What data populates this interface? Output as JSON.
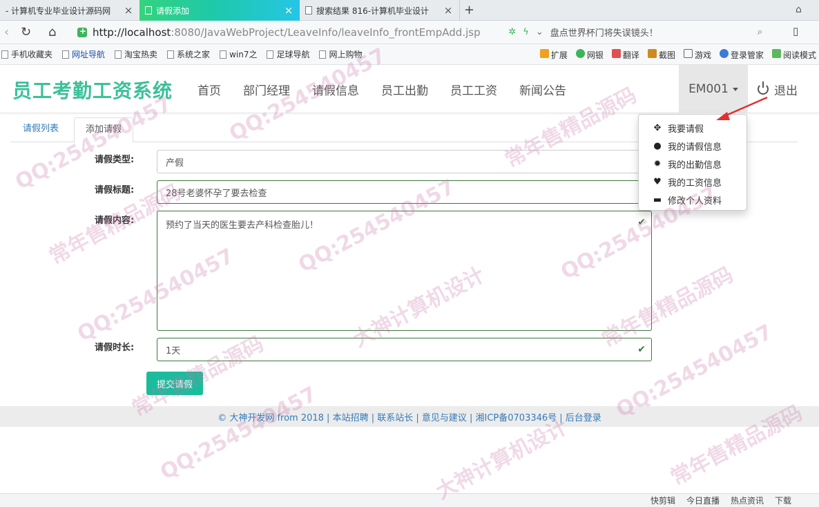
{
  "browser": {
    "tabs": [
      {
        "title": "- 计算机专业毕业设计源码网"
      },
      {
        "title": "请假添加"
      },
      {
        "title": "搜索结果 816-计算机毕业设计"
      }
    ],
    "url_host": "http://localhost",
    "url_rest": ":8080/JavaWebProject/LeaveInfo/leaveInfo_frontEmpAdd.jsp",
    "hot_search": "盘点世界杯门将失误镜头！",
    "bookmarks": [
      "手机收藏夹",
      "网址导航",
      "淘宝热卖",
      "系统之家",
      "win7之",
      "足球导航",
      "网上购物"
    ],
    "tools": [
      "扩展",
      "网银",
      "翻译",
      "截图",
      "游戏",
      "登录管家",
      "阅读模式"
    ],
    "status": [
      "快剪辑",
      "今日直播",
      "热点资讯",
      "下载"
    ]
  },
  "site": {
    "brand": "员工考勤工资系统",
    "menu": [
      "首页",
      "部门经理",
      "请假信息",
      "员工出勤",
      "员工工资",
      "新闻公告"
    ],
    "user": "EM001",
    "logout": "退出",
    "dropdown": [
      {
        "label": "我要请假",
        "icon": "move-icon"
      },
      {
        "label": "我的请假信息",
        "icon": "user-icon"
      },
      {
        "label": "我的出勤信息",
        "icon": "cog-icon"
      },
      {
        "label": "我的工资信息",
        "icon": "heart-icon"
      },
      {
        "label": "修改个人资料",
        "icon": "credit-card-icon"
      }
    ]
  },
  "content_tabs": [
    "请假列表",
    "添加请假"
  ],
  "form": {
    "type_label": "请假类型:",
    "type_value": "产假",
    "title_label": "请假标题:",
    "title_value": "28号老婆怀孕了要去检查",
    "content_label": "请假内容:",
    "content_value": "预约了当天的医生要去产科检查胎儿！",
    "duration_label": "请假时长:",
    "duration_value": "1天",
    "submit": "提交请假"
  },
  "footer": "© 大神开发网 from 2018 | 本站招聘 | 联系站长 | 意见与建议 | 湘ICP备0703346号 | 后台登录",
  "watermarks": [
    "QQ:254540457",
    "常年售精品源码",
    "大神计算机设计"
  ]
}
